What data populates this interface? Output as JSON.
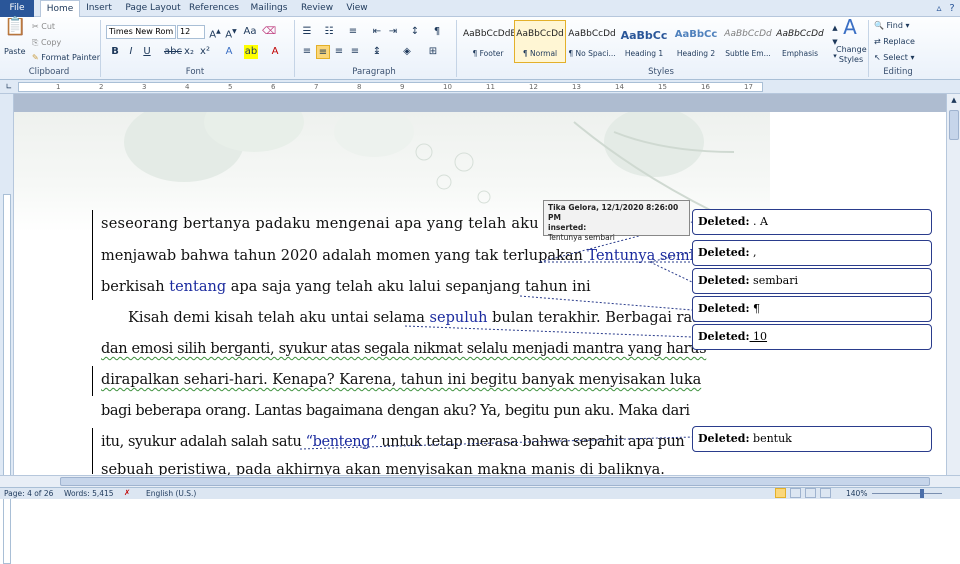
{
  "tabs": [
    "File",
    "Home",
    "Insert",
    "Page Layout",
    "References",
    "Mailings",
    "Review",
    "View"
  ],
  "clipboard": {
    "paste": "Paste",
    "cut": "Cut",
    "copy": "Copy",
    "format_painter": "Format Painter",
    "label": "Clipboard"
  },
  "font": {
    "name": "Times New Rom",
    "size": "12",
    "label": "Font"
  },
  "paragraph": {
    "label": "Paragraph"
  },
  "styles": {
    "items": [
      {
        "preview": "AaBbCcDdE",
        "name": "¶ Footer"
      },
      {
        "preview": "AaBbCcDd",
        "name": "¶ Normal"
      },
      {
        "preview": "AaBbCcDd",
        "name": "¶ No Spaci..."
      },
      {
        "preview": "AaBbCc",
        "name": "Heading 1"
      },
      {
        "preview": "AaBbCc",
        "name": "Heading 2"
      },
      {
        "preview": "AaBbCcDd",
        "name": "Subtle Em..."
      },
      {
        "preview": "AaBbCcDd",
        "name": "Emphasis"
      }
    ],
    "change_styles": "Change Styles",
    "label": "Styles"
  },
  "editing": {
    "find": "Find",
    "replace": "Replace",
    "select": "Select",
    "label": "Editing"
  },
  "document": {
    "lines": [
      {
        "pre": "seseorang bertanya padaku mengenai apa yang telah aku lalui di",
        "ins": ""
      },
      {
        "pre": "menjawab bahwa tahun 2020 adalah momen yang tak terlupakan",
        "ins": "Tentunya sembari"
      },
      {
        "pre": "berkisah ",
        "ins": "tentang",
        "post": " apa saja yang telah aku lalui sepanjang tahun ini"
      },
      {
        "pre": "Kisah demi kisah telah aku untai selama ",
        "ins": "sepuluh",
        "post": " bulan terakhir. Berbagai rasa"
      },
      {
        "pre": "dan emosi silih berganti, syukur atas segala nikmat selalu menjadi mantra yang harus"
      },
      {
        "pre": "dirapalkan sehari-hari. Kenapa? Karena, tahun ini begitu banyak menyisakan luka"
      },
      {
        "pre": "bagi beberapa orang. Lantas bagaimana dengan aku? Ya, begitu pun aku. Maka dari"
      },
      {
        "pre": "itu, syukur adalah salah satu ",
        "ins": "“benteng”",
        "post": " untuk tetap merasa bahwa sepahit apa pun"
      },
      {
        "pre": "sebuah peristiwa, pada akhirnya akan menyisakan makna manis di baliknya."
      }
    ]
  },
  "tooltip": {
    "author": "Tika Gelora, 12/1/2020 8:26:00 PM",
    "action": "inserted:",
    "text": "Tentunya sembari"
  },
  "balloons": [
    {
      "label": "Deleted:",
      "text": " . A"
    },
    {
      "label": "Deleted:",
      "text": " ,"
    },
    {
      "label": "Deleted:",
      "text": " sembari"
    },
    {
      "label": "Deleted:",
      "text": " ¶"
    },
    {
      "label": "Deleted:",
      "text": " 10"
    },
    {
      "label": "Deleted:",
      "text": " bentuk"
    }
  ],
  "status": {
    "page": "Page: 4 of 26",
    "words": "Words: 5,415",
    "lang": "English (U.S.)",
    "zoom": "140%"
  }
}
